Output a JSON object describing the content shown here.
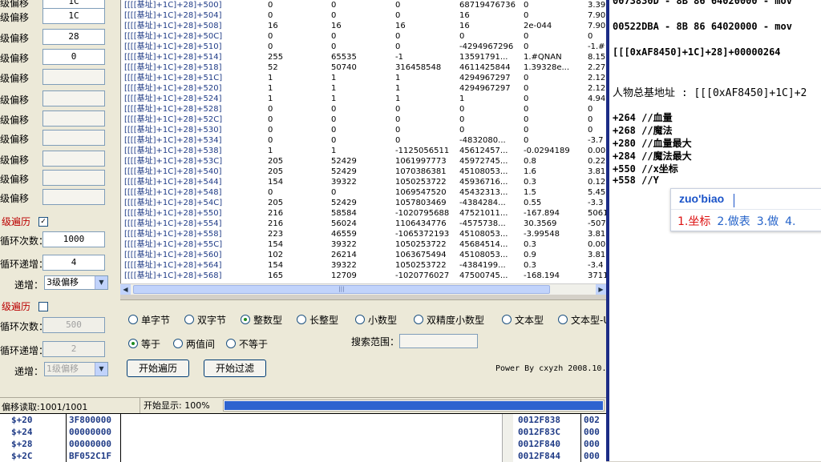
{
  "left_panel": {
    "rows": [
      {
        "label": "级偏移",
        "value": "1C"
      },
      {
        "label": "级偏移",
        "value": "28"
      },
      {
        "label": "级偏移",
        "value": "0"
      },
      {
        "label": "级偏移",
        "value": ""
      },
      {
        "label": "级偏移",
        "value": ""
      },
      {
        "label": "级偏移",
        "value": ""
      },
      {
        "label": "级偏移",
        "value": ""
      },
      {
        "label": "级偏移",
        "value": ""
      },
      {
        "label": "级偏移",
        "value": ""
      },
      {
        "label": "级偏移",
        "value": ""
      }
    ],
    "group1": {
      "title": "级遍历",
      "checked": true,
      "loop_count_label": "循环次数：",
      "loop_count": "1000",
      "loop_inc_label": "循环递增：",
      "loop_inc": "4",
      "inc_label": "递增：",
      "inc_select": "3级偏移"
    },
    "group2": {
      "title": "级遍历",
      "checked": false,
      "loop_count_label": "循环次数：",
      "loop_count": "500",
      "loop_inc_label": "循环递增：",
      "loop_inc": "2",
      "inc_label": "递增：",
      "inc_select": "1级偏移"
    }
  },
  "grid": {
    "rows": [
      [
        "[[[[基址]+1C]+28]+500]",
        "0",
        "0",
        "0",
        "68719476736",
        "0",
        "3.39"
      ],
      [
        "[[[[基址]+1C]+28]+504]",
        "0",
        "0",
        "0",
        "16",
        "0",
        "7.90"
      ],
      [
        "[[[[基址]+1C]+28]+508]",
        "16",
        "16",
        "16",
        "16",
        "2e-044",
        "7.90"
      ],
      [
        "[[[[基址]+1C]+28]+50C]",
        "0",
        "0",
        "0",
        "0",
        "0",
        "0"
      ],
      [
        "[[[[基址]+1C]+28]+510]",
        "0",
        "0",
        "0",
        "-4294967296",
        "0",
        "-1.#"
      ],
      [
        "[[[[基址]+1C]+28]+514]",
        "255",
        "65535",
        "-1",
        "13591791...",
        "1.#QNAN",
        "8.15"
      ],
      [
        "[[[[基址]+1C]+28]+518]",
        "52",
        "50740",
        "316458548",
        "4611425844",
        "1.39328e...",
        "2.27"
      ],
      [
        "[[[[基址]+1C]+28]+51C]",
        "1",
        "1",
        "1",
        "4294967297",
        "0",
        "2.12"
      ],
      [
        "[[[[基址]+1C]+28]+520]",
        "1",
        "1",
        "1",
        "4294967297",
        "0",
        "2.12"
      ],
      [
        "[[[[基址]+1C]+28]+524]",
        "1",
        "1",
        "1",
        "1",
        "0",
        "4.94"
      ],
      [
        "[[[[基址]+1C]+28]+528]",
        "0",
        "0",
        "0",
        "0",
        "0",
        "0"
      ],
      [
        "[[[[基址]+1C]+28]+52C]",
        "0",
        "0",
        "0",
        "0",
        "0",
        "0"
      ],
      [
        "[[[[基址]+1C]+28]+530]",
        "0",
        "0",
        "0",
        "0",
        "0",
        "0"
      ],
      [
        "[[[[基址]+1C]+28]+534]",
        "0",
        "0",
        "0",
        "-4832080...",
        "0",
        "-3.7"
      ],
      [
        "[[[[基址]+1C]+28]+538]",
        "1",
        "1",
        "-1125056511",
        "45612457...",
        "-0.0294189",
        "0.00"
      ],
      [
        "[[[[基址]+1C]+28]+53C]",
        "205",
        "52429",
        "1061997773",
        "45972745...",
        "0.8",
        "0.22"
      ],
      [
        "[[[[基址]+1C]+28]+540]",
        "205",
        "52429",
        "1070386381",
        "45108053...",
        "1.6",
        "3.81"
      ],
      [
        "[[[[基址]+1C]+28]+544]",
        "154",
        "39322",
        "1050253722",
        "45936716...",
        "0.3",
        "0.12"
      ],
      [
        "[[[[基址]+1C]+28]+548]",
        "0",
        "0",
        "1069547520",
        "45432313...",
        "1.5",
        "5.45"
      ],
      [
        "[[[[基址]+1C]+28]+54C]",
        "205",
        "52429",
        "1057803469",
        "-4384284...",
        "0.55",
        "-3.3"
      ],
      [
        "[[[[基址]+1C]+28]+550]",
        "216",
        "58584",
        "-1020795688",
        "47521011...",
        "-167.894",
        "5061"
      ],
      [
        "[[[[基址]+1C]+28]+554]",
        "216",
        "56024",
        "1106434776",
        "-4575738...",
        "30.3569",
        "-507"
      ],
      [
        "[[[[基址]+1C]+28]+558]",
        "223",
        "46559",
        "-1065372193",
        "45108053...",
        "-3.99548",
        "3.81"
      ],
      [
        "[[[[基址]+1C]+28]+55C]",
        "154",
        "39322",
        "1050253722",
        "45684514...",
        "0.3",
        "0.00"
      ],
      [
        "[[[[基址]+1C]+28]+560]",
        "102",
        "26214",
        "1063675494",
        "45108053...",
        "0.9",
        "3.81"
      ],
      [
        "[[[[基址]+1C]+28]+564]",
        "154",
        "39322",
        "1050253722",
        "-4384199...",
        "0.3",
        "-3.4"
      ],
      [
        "[[[[基址]+1C]+28]+568]",
        "165",
        "12709",
        "-1020776027",
        "47500745...",
        "-168.194",
        "3711"
      ]
    ]
  },
  "options": {
    "types": [
      "单字节",
      "双字节",
      "整数型",
      "长整型",
      "小数型",
      "双精度小数型",
      "文本型",
      "文本型-U"
    ],
    "selected_type": "整数型",
    "compare": [
      "等于",
      "两值间",
      "不等于"
    ],
    "selected_compare": "等于",
    "search_range_label": "搜索范围：",
    "start_traverse": "开始遍历",
    "start_filter": "开始过滤",
    "credit": "Power By cxyzh 2008.10."
  },
  "status": {
    "offset_read": "偏移读取:1001/1001",
    "start_display": "开始显示: 100%",
    "progress": 1.0
  },
  "dump": {
    "rows": [
      {
        "off": "$+20",
        "val": "3F800000",
        "addr": "0012F838",
        "addr2": "002"
      },
      {
        "off": "$+24",
        "val": "00000000",
        "addr": "0012F83C",
        "addr2": "000"
      },
      {
        "off": "$+28",
        "val": "00000000",
        "addr": "0012F840",
        "addr2": "000"
      },
      {
        "off": "$+2C",
        "val": "BF052C1F",
        "addr": "0012F844",
        "addr2": "000"
      }
    ]
  },
  "notes": {
    "line1": "0073830D - 8B 86 64020000  - mov",
    "line2": "00522DBA - 8B 86 64020000  - mov",
    "line3": "[[[0xAF8450]+1C]+28]+00000264",
    "line4": "人物总基地址 : [[[0xAF8450]+1C]+2",
    "fields": [
      "+264  //血量",
      "+268  //魔法",
      "+280  //血量最大",
      "+284  //魔法最大",
      "+550  //x坐标",
      "+558  //Y"
    ]
  },
  "ime": {
    "composition": "zuo'biao",
    "candidates": [
      "1.坐标",
      "2.做表",
      "3.做",
      "4."
    ]
  }
}
